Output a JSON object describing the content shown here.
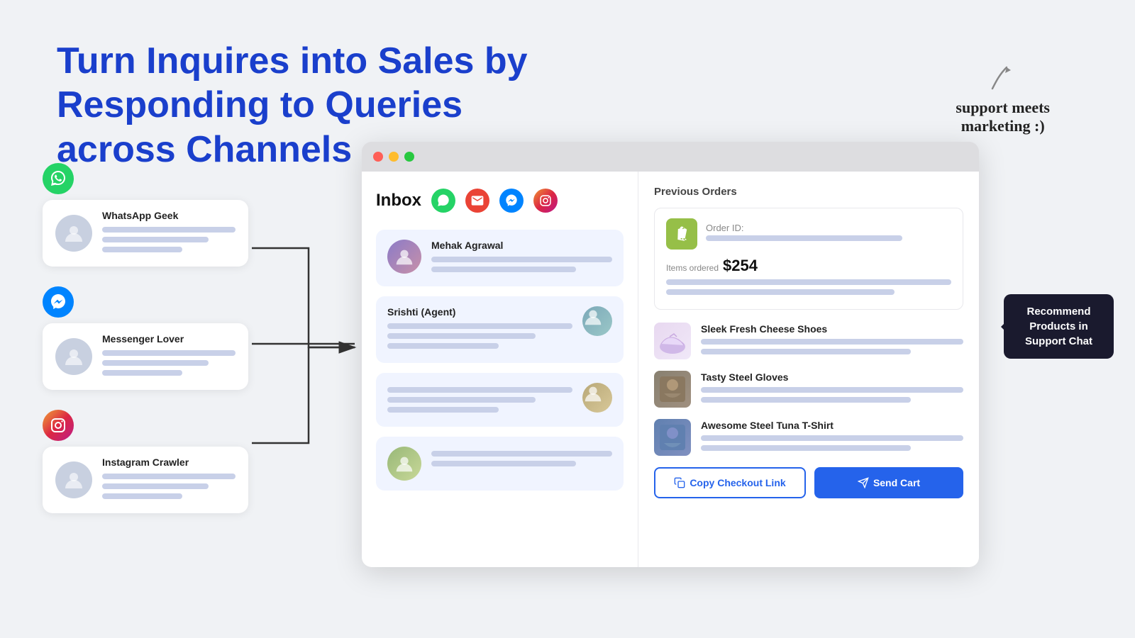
{
  "hero": {
    "highlighted": "Turn Inquires into Sales",
    "rest": " by Responding to Queries across Channels"
  },
  "badge": {
    "line1": "support meets",
    "line2": "marketing :)"
  },
  "channels": [
    {
      "icon": "💬",
      "icon_type": "whatsapp",
      "name": "WhatsApp Geek"
    },
    {
      "icon": "💬",
      "icon_type": "messenger",
      "name": "Messenger Lover"
    },
    {
      "icon": "📷",
      "icon_type": "instagram",
      "name": "Instagram Crawler"
    }
  ],
  "inbox": {
    "title": "Inbox",
    "channels": [
      "whatsapp",
      "email",
      "messenger",
      "instagram"
    ],
    "conversations": [
      {
        "name": "Mehak Agrawal",
        "has_right_avatar": false
      },
      {
        "name": "Srishti (Agent)",
        "has_right_avatar": true
      },
      {
        "name": "",
        "has_right_avatar": true
      },
      {
        "name": "",
        "has_right_avatar": false
      }
    ]
  },
  "right_panel": {
    "previous_orders_label": "Previous Orders",
    "order": {
      "order_id_label": "Order ID:",
      "items_label": "Items ordered",
      "amount": "$254"
    },
    "products": [
      {
        "name": "Sleek Fresh Cheese Shoes",
        "type": "shoes"
      },
      {
        "name": "Tasty Steel Gloves",
        "type": "gloves"
      },
      {
        "name": "Awesome Steel Tuna T-Shirt",
        "type": "tshirt"
      }
    ],
    "tooltip": "Recommend Products in Support Chat",
    "buttons": {
      "copy": "Copy Checkout Link",
      "send": "Send Cart"
    }
  }
}
